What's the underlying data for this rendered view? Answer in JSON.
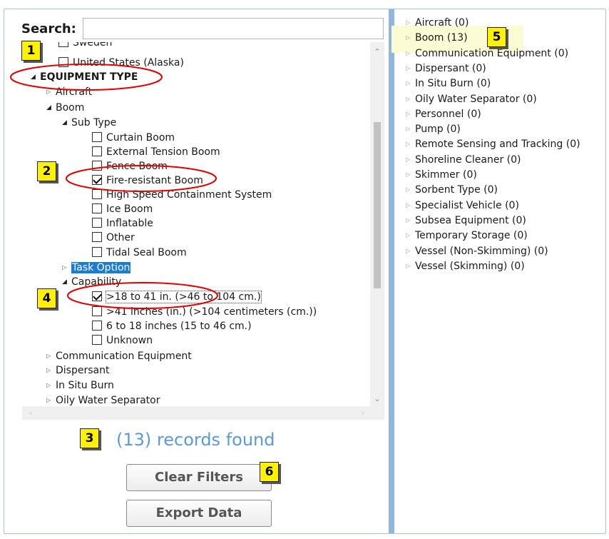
{
  "search": {
    "label": "Search:",
    "value": "",
    "placeholder": ""
  },
  "tree": {
    "rows": [
      {
        "text": "Sweden",
        "type": "cb",
        "checked": false
      },
      {
        "text": "United States (Alaska)",
        "type": "cb",
        "checked": false
      },
      {
        "text": "EQUIPMENT TYPE",
        "type": "node",
        "expanded": true,
        "bold": true
      },
      {
        "text": "Aircraft",
        "type": "node",
        "expanded": false
      },
      {
        "text": "Boom",
        "type": "node",
        "expanded": true
      },
      {
        "text": "Sub Type",
        "type": "node",
        "expanded": true
      },
      {
        "text": "Curtain Boom",
        "type": "cb",
        "checked": false
      },
      {
        "text": "External Tension Boom",
        "type": "cb",
        "checked": false
      },
      {
        "text": "Fence Boom",
        "type": "cb",
        "checked": false
      },
      {
        "text": "Fire-resistant Boom",
        "type": "cb",
        "checked": true
      },
      {
        "text": "High Speed Containment System",
        "type": "cb",
        "checked": false
      },
      {
        "text": "Ice Boom",
        "type": "cb",
        "checked": false
      },
      {
        "text": "Inflatable",
        "type": "cb",
        "checked": false
      },
      {
        "text": "Other",
        "type": "cb",
        "checked": false
      },
      {
        "text": "Tidal Seal Boom",
        "type": "cb",
        "checked": false
      },
      {
        "text": "Task Option",
        "type": "node",
        "expanded": false,
        "selected": true
      },
      {
        "text": "Capability",
        "type": "node",
        "expanded": true
      },
      {
        "text": ">18 to 41 in. (>46 to 104 cm.)",
        "type": "cb",
        "checked": true
      },
      {
        "text": ">41 inches (in.) (>104 centimeters (cm.))",
        "type": "cb",
        "checked": false
      },
      {
        "text": "6 to 18 inches (15 to 46 cm.)",
        "type": "cb",
        "checked": false
      },
      {
        "text": "Unknown",
        "type": "cb",
        "checked": false
      },
      {
        "text": "Communication Equipment",
        "type": "node",
        "expanded": false
      },
      {
        "text": "Dispersant",
        "type": "node",
        "expanded": false
      },
      {
        "text": "In Situ Burn",
        "type": "node",
        "expanded": false
      },
      {
        "text": "Oily Water Separator",
        "type": "node",
        "expanded": false
      }
    ]
  },
  "results": [
    "Aircraft (0)",
    "Boom (13)",
    "Communication Equipment (0)",
    "Dispersant (0)",
    "In Situ Burn (0)",
    "Oily Water Separator (0)",
    "Personnel (0)",
    "Pump (0)",
    "Remote Sensing and Tracking (0)",
    "Shoreline Cleaner (0)",
    "Skimmer (0)",
    "Sorbent Type (0)",
    "Specialist Vehicle (0)",
    "Subsea Equipment (0)",
    "Temporary Storage (0)",
    "Vessel (Non-Skimming) (0)",
    "Vessel (Skimming) (0)"
  ],
  "records_found": "(13) records found",
  "buttons": {
    "clear": "Clear Filters",
    "export": "Export Data"
  },
  "badges": [
    "1",
    "2",
    "3",
    "4",
    "5",
    "6"
  ],
  "colors": {
    "accent": "#5b9bd5",
    "selection": "#1b7cd6",
    "annotation": "#e00000",
    "badge": "#fff200",
    "divider": "#8fb6de"
  },
  "icons": {
    "expanded": "expanded-triangle-icon",
    "collapsed": "collapsed-triangle-icon",
    "checkbox": "checkbox-icon"
  }
}
